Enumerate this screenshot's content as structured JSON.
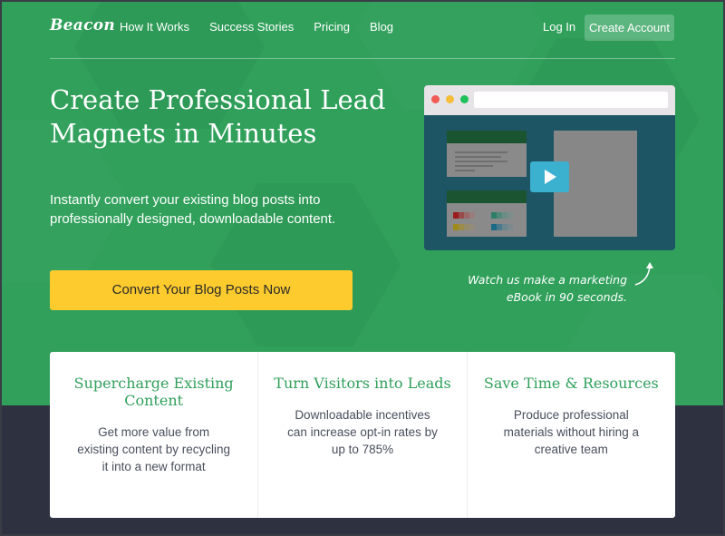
{
  "brand": {
    "logo": "Beacon"
  },
  "nav": {
    "items": [
      "How It Works",
      "Success Stories",
      "Pricing",
      "Blog"
    ],
    "login": "Log In",
    "create_account": "Create Account"
  },
  "hero": {
    "headline": "Create Professional Lead Magnets in Minutes",
    "subheadline": "Instantly convert your existing blog posts into professionally designed, downloadable content.",
    "cta": "Convert Your Blog Posts Now",
    "video_caption": "Watch us make a marketing eBook in 90 seconds."
  },
  "features": [
    {
      "title": "Supercharge Existing Content",
      "body": "Get more value from existing content by recycling it into a new format"
    },
    {
      "title": "Turn Visitors into Leads",
      "body": "Downloadable incentives can increase opt-in rates by up to 785%"
    },
    {
      "title": "Save Time & Resources",
      "body": "Produce professional materials without hiring a creative team"
    }
  ],
  "colors": {
    "brand_green": "#30a05b",
    "cta_yellow": "#fdcb2e",
    "footer_navy": "#2e3140",
    "play_blue": "#3bb0cf"
  }
}
